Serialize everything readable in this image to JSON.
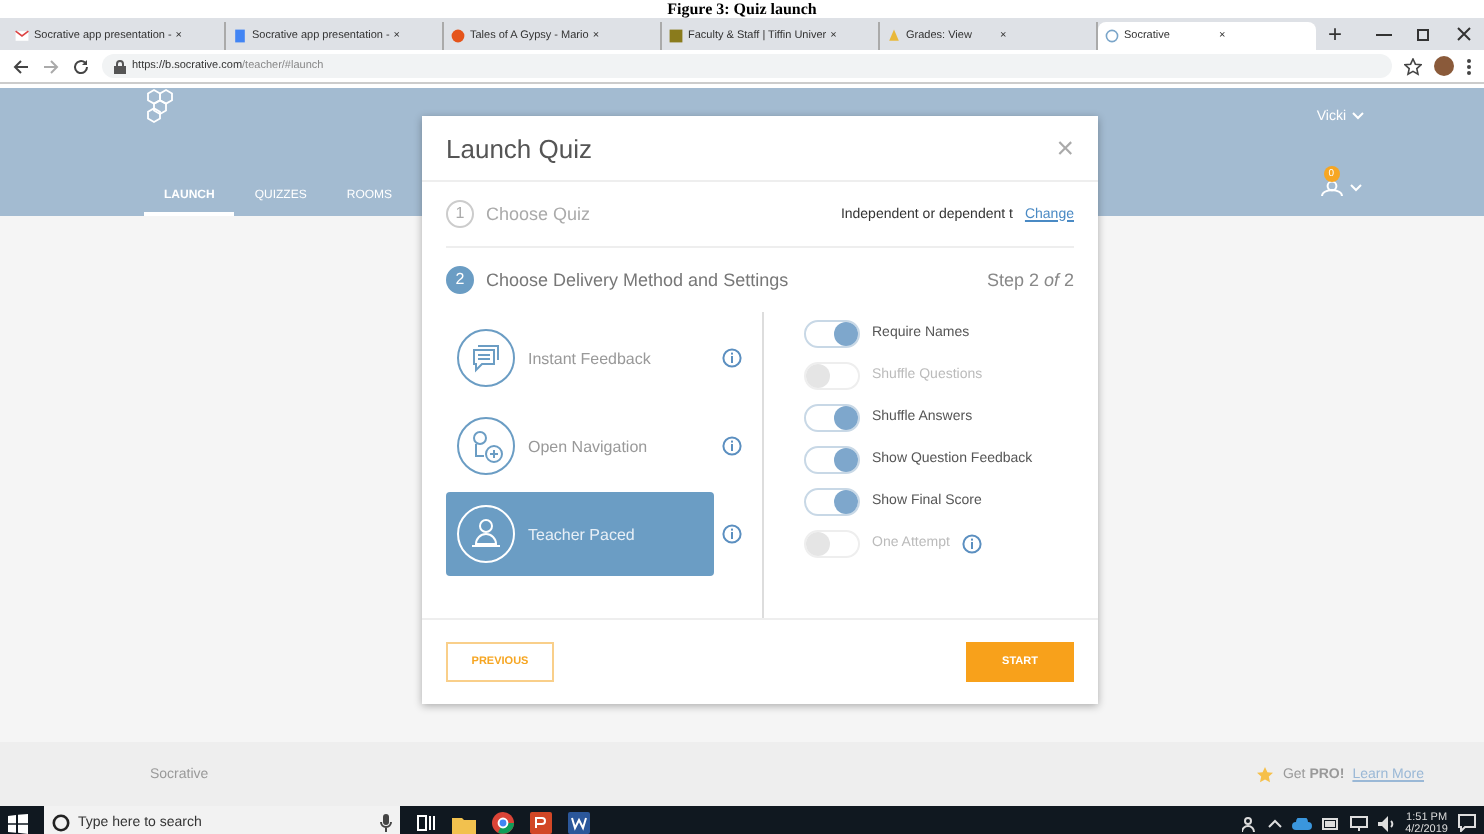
{
  "caption": "Figure 3: Quiz launch",
  "browser": {
    "tabs": [
      {
        "title": "Socrative app presentation -",
        "selected": false,
        "kind": "mail"
      },
      {
        "title": "Socrative app presentation -",
        "selected": false,
        "kind": "doc"
      },
      {
        "title": "Tales of A Gypsy - Mario",
        "selected": false,
        "kind": "music"
      },
      {
        "title": "Faculty & Staff | Tiffin Univer",
        "selected": false,
        "kind": "school"
      },
      {
        "title": "Grades: View",
        "selected": false,
        "kind": "grades"
      },
      {
        "title": "Socrative",
        "selected": true,
        "kind": "app"
      }
    ],
    "tab_close": "×",
    "new_tab": "+",
    "url_host": "https://b.socrative.com",
    "url_path": "/teacher/#launch"
  },
  "header": {
    "nav": [
      {
        "label": "LAUNCH",
        "selected": true
      },
      {
        "label": "QUIZZES",
        "selected": false
      },
      {
        "label": "ROOMS",
        "selected": false
      }
    ],
    "user": "Vicki",
    "badge": "0"
  },
  "modal": {
    "title": "Launch Quiz",
    "close": "×",
    "step1": {
      "active": false,
      "number": "1",
      "label": "Choose Quiz",
      "quiz": "Independent or dependent t",
      "change": "Change"
    },
    "step2": {
      "active": true,
      "number": "2",
      "label": "Choose Delivery Method and Settings",
      "progress": "Step 2 *of* 2"
    },
    "methods": [
      {
        "label": "Instant Feedback",
        "kind": "feedback",
        "selected": false
      },
      {
        "label": "Open Navigation",
        "kind": "navigation",
        "selected": false
      },
      {
        "label": "Teacher Paced",
        "kind": "teacher",
        "selected": true
      }
    ],
    "settings": [
      {
        "label": "Require Names",
        "on": true,
        "info": false
      },
      {
        "label": "Shuffle Questions",
        "on": false,
        "info": false
      },
      {
        "label": "Shuffle Answers",
        "on": true,
        "info": false
      },
      {
        "label": "Show Question Feedback",
        "on": true,
        "info": false
      },
      {
        "label": "Show Final Score",
        "on": true,
        "info": false
      },
      {
        "label": "One Attempt",
        "on": false,
        "info": true
      }
    ],
    "buttons": {
      "previous": "PREVIOUS",
      "start": "START"
    }
  },
  "footer": {
    "brand": "Socrative",
    "promo": "Get **PRO!**",
    "link": "Learn More"
  },
  "taskbar": {
    "search": "Type here to search",
    "time": "1:51 PM",
    "date": "4/2/2019"
  }
}
